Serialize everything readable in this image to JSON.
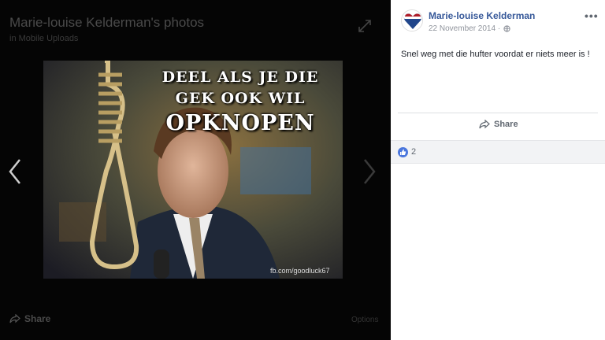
{
  "viewer": {
    "album_title": "Marie-louise Kelderman's photos",
    "album_subtitle": "in Mobile Uploads",
    "photo": {
      "caption_line1": "DEEL ALS JE DIE",
      "caption_line2": "GEK OOK WIL",
      "caption_line3": "OPKNOPEN",
      "watermark": "fb.com/goodluck67"
    },
    "share_label": "Share",
    "options_label": "Options"
  },
  "post": {
    "author": "Marie-louise Kelderman",
    "date": "22 November 2014 ·",
    "privacy_icon": "globe-icon",
    "text": "Snel weg met die hufter voordat er niets meer is !",
    "share_label": "Share",
    "like_count": "2"
  },
  "colors": {
    "link_blue": "#365899",
    "like_blue": "#4a76dd"
  }
}
